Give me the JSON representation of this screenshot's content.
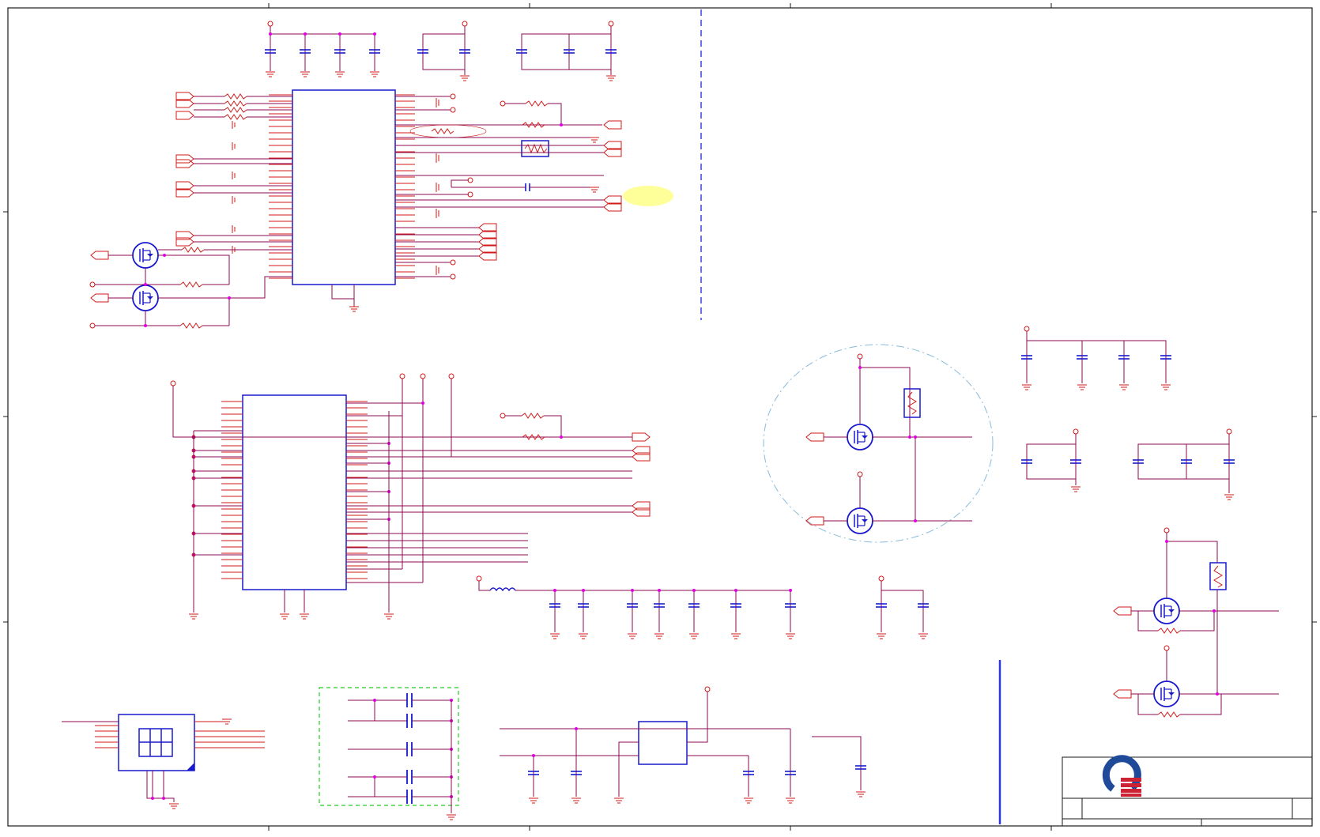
{
  "sheet": {
    "title": "",
    "zone_marks": []
  },
  "colors": {
    "wire": "#8b0a50",
    "component": "#d01a1a",
    "symbol": "#1a1acd",
    "junction": "#e000e0",
    "border": "#1a1a1a",
    "divider": "#2a3ad8",
    "highlight": "#ffff99",
    "group_box": "#22cc22",
    "circle_outline": "#88bbdd",
    "logo_blue": "#1f4a9a",
    "logo_red": "#cc2233"
  },
  "title_block": {
    "logo": "company-logo",
    "fields": []
  }
}
